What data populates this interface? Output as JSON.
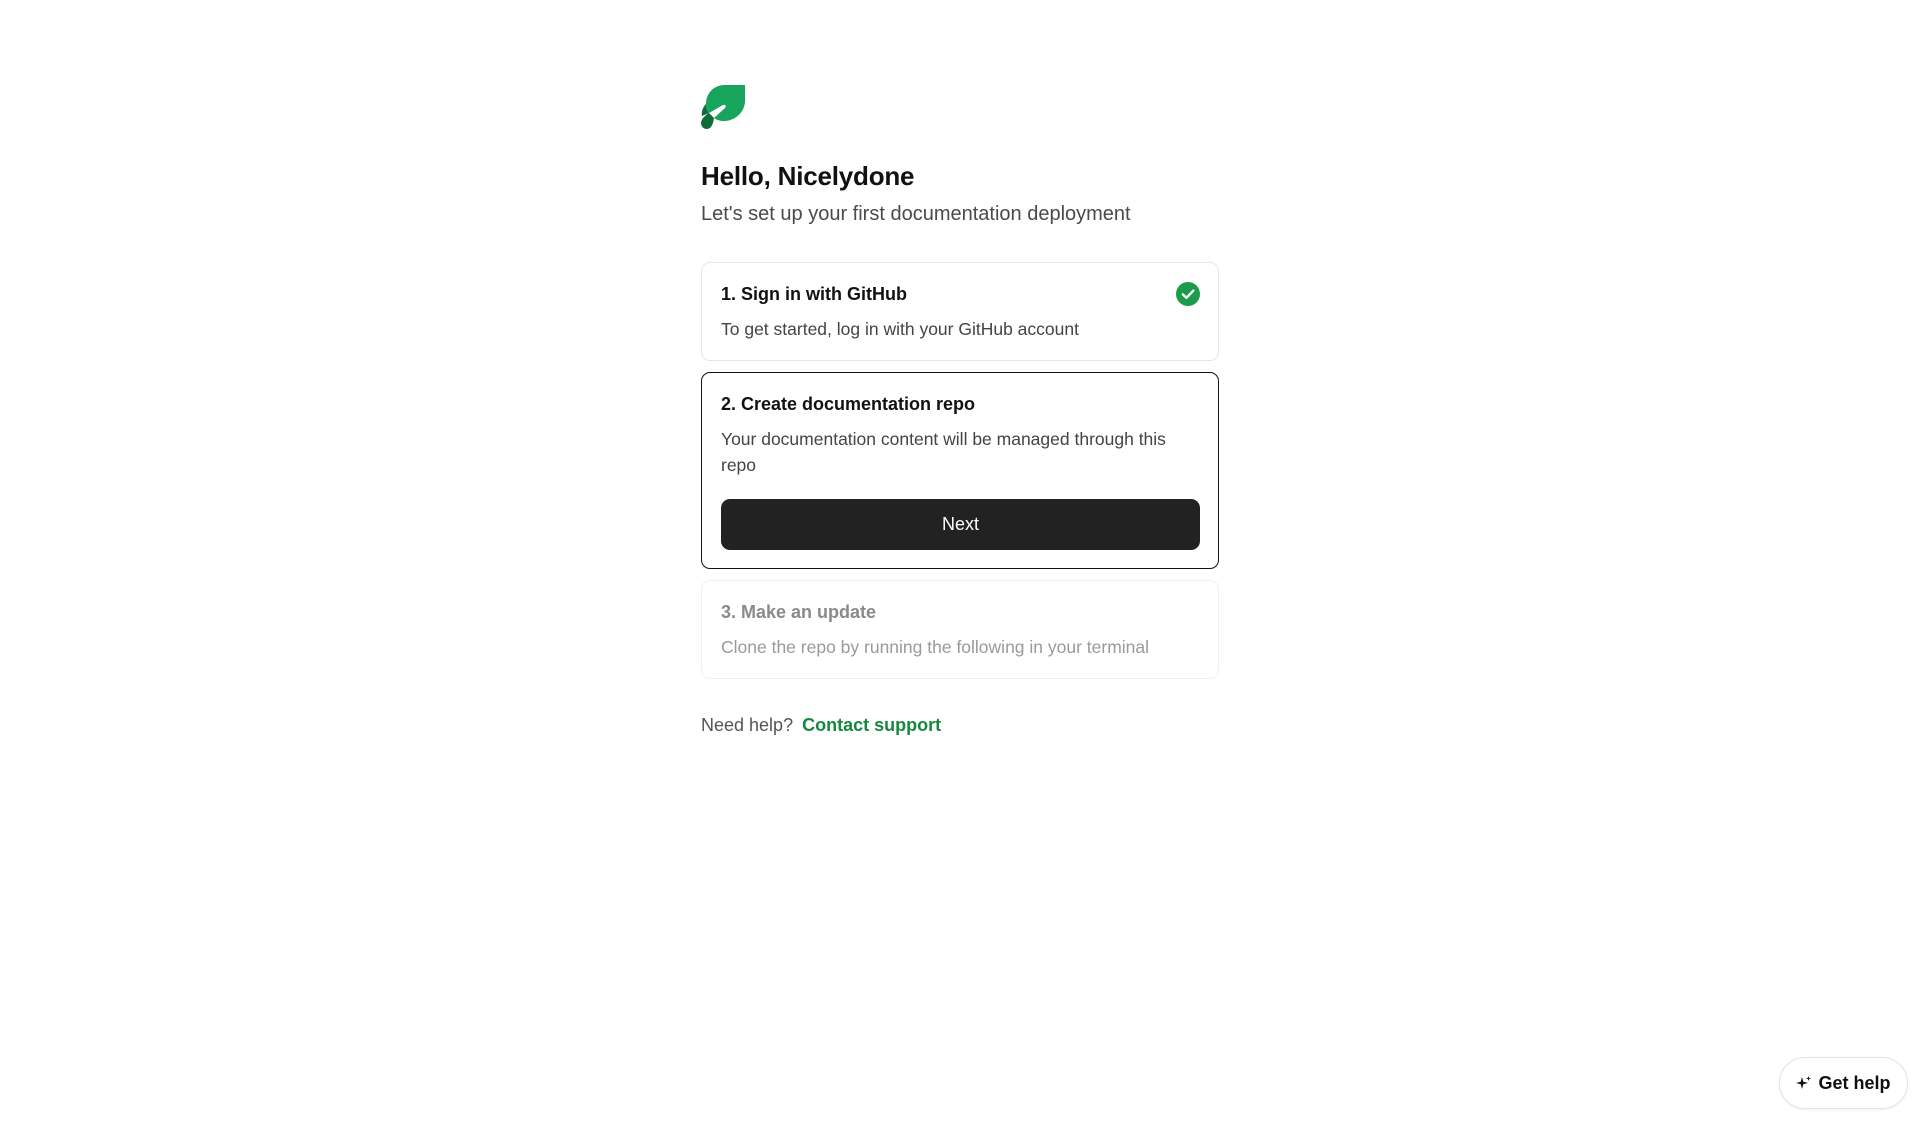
{
  "header": {
    "logo_icon": "leaf-logo-icon",
    "greeting": "Hello, Nicelydone",
    "subtitle": "Let's set up your first documentation deployment"
  },
  "steps": [
    {
      "title": "1. Sign in with GitHub",
      "description": "To get started, log in with your GitHub account",
      "status": "completed",
      "status_icon": "check-circle-icon"
    },
    {
      "title": "2. Create documentation repo",
      "description": "Your documentation content will be managed through this repo",
      "status": "active",
      "button_label": "Next"
    },
    {
      "title": "3. Make an update",
      "description": "Clone the repo by running the following in your terminal",
      "status": "disabled"
    }
  ],
  "footer": {
    "help_prefix": "Need help?",
    "help_link": "Contact support"
  },
  "get_help": {
    "icon": "sparkle-icon",
    "label": "Get help"
  },
  "colors": {
    "brand_green": "#16873f",
    "button_dark": "#222222",
    "check_green": "#1a9c4a"
  }
}
